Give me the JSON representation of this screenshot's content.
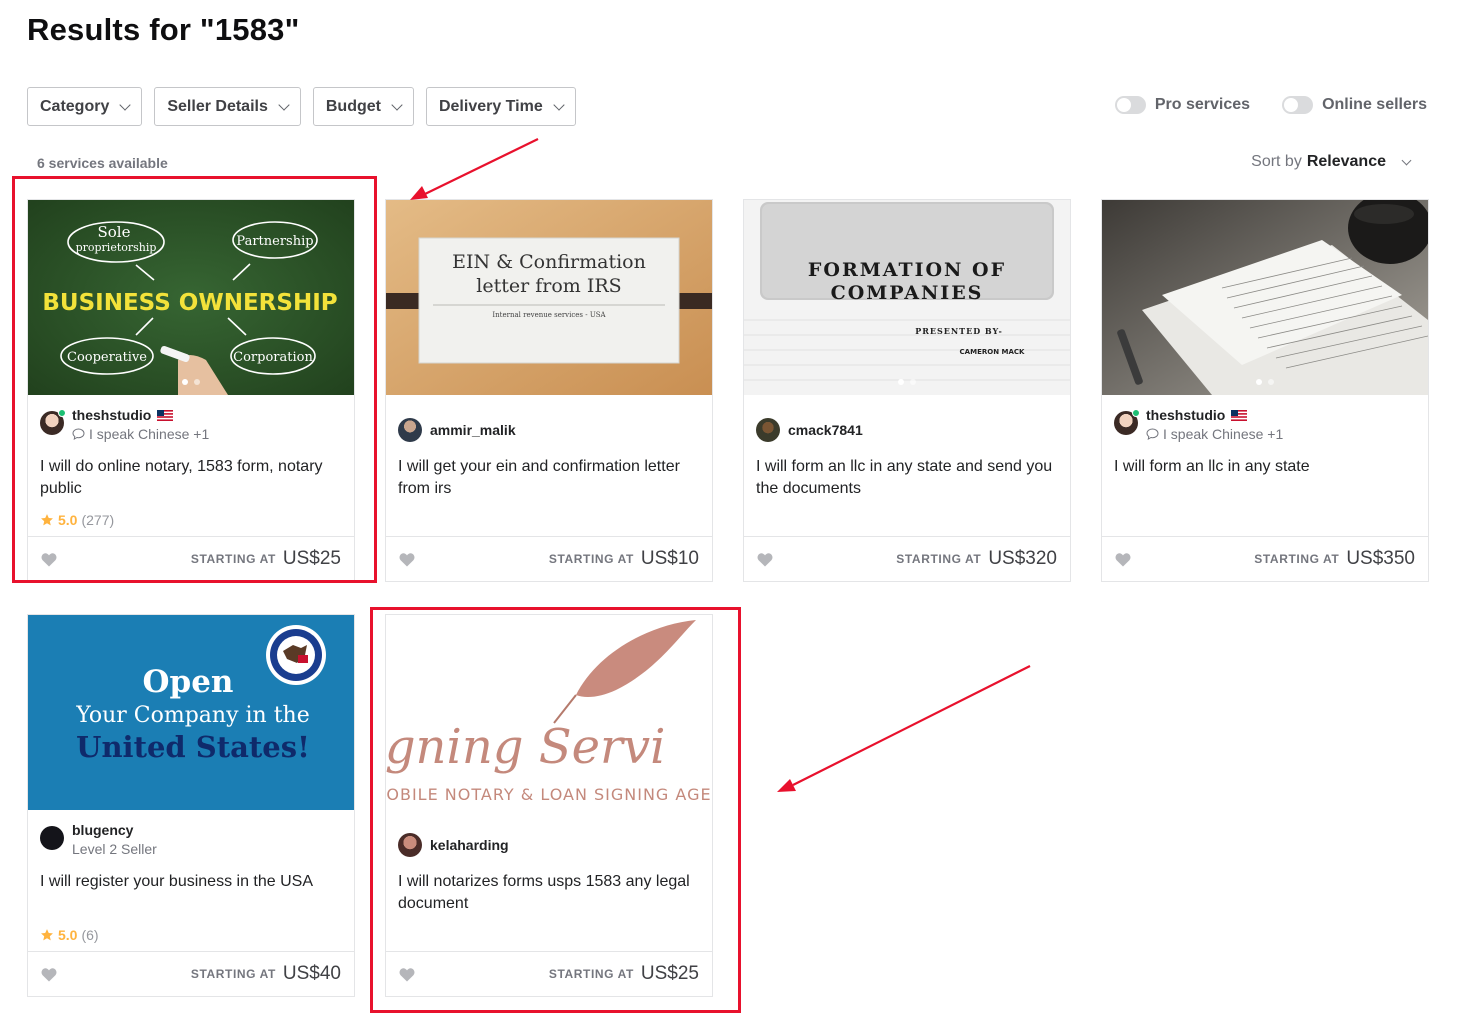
{
  "page": {
    "title": "Results for \"1583\""
  },
  "filters": [
    {
      "label": "Category"
    },
    {
      "label": "Seller Details"
    },
    {
      "label": "Budget"
    },
    {
      "label": "Delivery Time"
    }
  ],
  "toggles": {
    "pro": "Pro services",
    "online": "Online sellers"
  },
  "results": {
    "count": "6 services available",
    "sort_prefix": "Sort by",
    "sort_value": "Relevance"
  },
  "price_label": "STARTING AT",
  "cards": [
    {
      "seller": "theshstudio",
      "sub": "I speak Chinese +1",
      "title": "I will do online notary, 1583 form, notary public",
      "rating": "5.0",
      "reviews": "(277)",
      "price": "US$25",
      "thumb_text": {
        "t1": "Sole",
        "t2": "proprietorship",
        "t3": "Partnership",
        "t4": "BUSINESS OWNERSHIP",
        "t5": "Cooperative",
        "t6": "Corporation"
      }
    },
    {
      "seller": "ammir_malik",
      "title": "I will get your ein and confirmation letter from irs",
      "price": "US$10",
      "thumb_text": {
        "t1": "EIN & Confirmation",
        "t2": "letter from IRS",
        "t3": "Internal revenue services - USA"
      }
    },
    {
      "seller": "cmack7841",
      "title": "I will form an llc in any state and send you the documents",
      "price": "US$320",
      "thumb_text": {
        "t1": "FORMATION OF",
        "t2": "COMPANIES",
        "t3": "PRESENTED BY-",
        "t4": "CAMERON MACK"
      }
    },
    {
      "seller": "theshstudio",
      "sub": "I speak Chinese +1",
      "title": "I will form an llc in any state",
      "price": "US$350"
    },
    {
      "seller": "blugency",
      "sub": "Level 2 Seller",
      "title": "I will register your business in the USA",
      "rating": "5.0",
      "reviews": "(6)",
      "price": "US$40",
      "thumb_text": {
        "t1": "Open",
        "t2": "Your Company in the",
        "t3": "United States!"
      }
    },
    {
      "seller": "kelaharding",
      "title": "I will notarizes forms usps 1583 any legal document",
      "price": "US$25",
      "thumb_text": {
        "t1": "Signing Servi",
        "t2": "OBILE NOTARY & LOAN SIGNING AGE"
      }
    }
  ],
  "colors": {
    "highlight": "#e8112d",
    "rating": "#ffb33e",
    "online": "#1dbf73"
  },
  "icons": [
    "chevron-down-icon",
    "heart-icon",
    "star-icon",
    "chat-bubble-icon",
    "us-flag-icon"
  ]
}
